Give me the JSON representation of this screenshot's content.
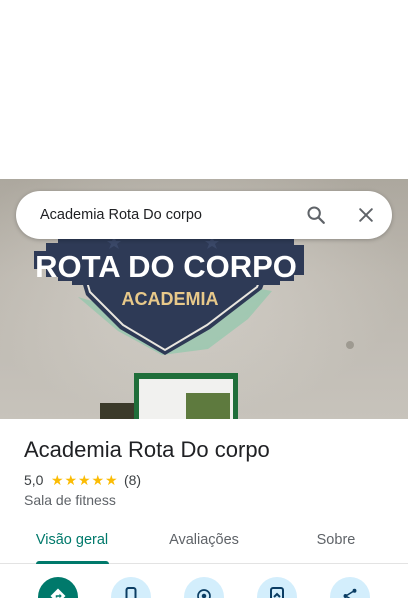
{
  "search": {
    "query": "Academia Rota Do corpo",
    "search_icon": "search-icon",
    "close_icon": "close-icon"
  },
  "photo": {
    "sign_line1": "ROTA DO CORPO",
    "sign_line2": "ACADEMIA"
  },
  "place": {
    "name": "Academia Rota Do corpo",
    "rating": "5,0",
    "stars": 5,
    "review_count": "(8)",
    "category": "Sala de fitness"
  },
  "tabs": [
    {
      "label": "Visão geral",
      "active": true
    },
    {
      "label": "Avaliações",
      "active": false
    },
    {
      "label": "Sobre",
      "active": false
    }
  ],
  "actions": [
    {
      "icon": "directions-icon"
    },
    {
      "icon": "phone-icon"
    },
    {
      "icon": "location-icon"
    },
    {
      "icon": "save-icon"
    },
    {
      "icon": "share-icon"
    }
  ],
  "colors": {
    "accent": "#00796b",
    "star": "#fbbc04",
    "action_bg": "#d3eefc"
  }
}
